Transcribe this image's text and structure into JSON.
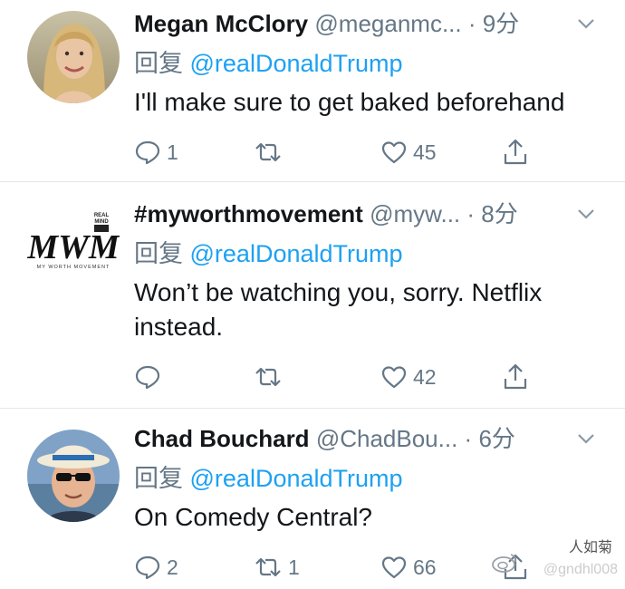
{
  "accent_color": "#1da1f2",
  "muted_color": "#657786",
  "tweets": [
    {
      "name": "Megan McClory",
      "handle": "@meganmc...",
      "separator": "·",
      "time": "9分",
      "reply_prefix": "回复",
      "mention": "@realDonaldTrump",
      "text": "I'll make sure to get baked beforehand",
      "reply_count": "1",
      "retweet_count": "",
      "like_count": "45",
      "avatar_icon": "woman-portrait-avatar"
    },
    {
      "name": "#myworthmovement",
      "handle": "@myw...",
      "separator": "·",
      "time": "8分",
      "reply_prefix": "回复",
      "mention": "@realDonaldTrump",
      "text": "Won’t be watching you, sorry. Netflix instead.",
      "reply_count": "",
      "retweet_count": "",
      "like_count": "42",
      "avatar_icon": "mwm-logo",
      "avatar_logo_text": "MWM",
      "avatar_logo_subtext": "MY WORTH MOVEMENT"
    },
    {
      "name": "Chad Bouchard",
      "handle": "@ChadBou...",
      "separator": "·",
      "time": "6分",
      "reply_prefix": "回复",
      "mention": "@realDonaldTrump",
      "text": "On Comedy Central?",
      "reply_count": "2",
      "retweet_count": "1",
      "like_count": "66",
      "avatar_icon": "man-with-hat-avatar"
    }
  ],
  "watermark": {
    "top": "人如菊",
    "bottom": "@gndhl008",
    "icon": "weibo-icon"
  }
}
